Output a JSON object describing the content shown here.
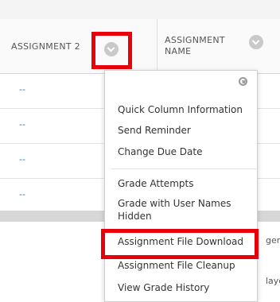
{
  "table": {
    "columns": [
      {
        "label": "ASSIGNMENT 2"
      },
      {
        "label": "ASSIGNMENT NAME"
      }
    ],
    "rows": [
      {
        "value": "--"
      },
      {
        "value": "--"
      },
      {
        "value": "--"
      },
      {
        "value": "--"
      }
    ]
  },
  "menu": {
    "items": [
      {
        "label": "Quick Column Information"
      },
      {
        "label": "Send Reminder"
      },
      {
        "label": "Change Due Date"
      },
      {
        "label": "Grade Attempts"
      },
      {
        "label": "Grade with User Names Hidden"
      },
      {
        "label": "Assignment File Download"
      },
      {
        "label": "Assignment File Cleanup"
      },
      {
        "label": "View Grade History"
      }
    ]
  },
  "background_peek": {
    "row1": "gen",
    "row2": "laye"
  },
  "colors": {
    "highlight": "#e8000b",
    "link": "#2b6bbd"
  }
}
